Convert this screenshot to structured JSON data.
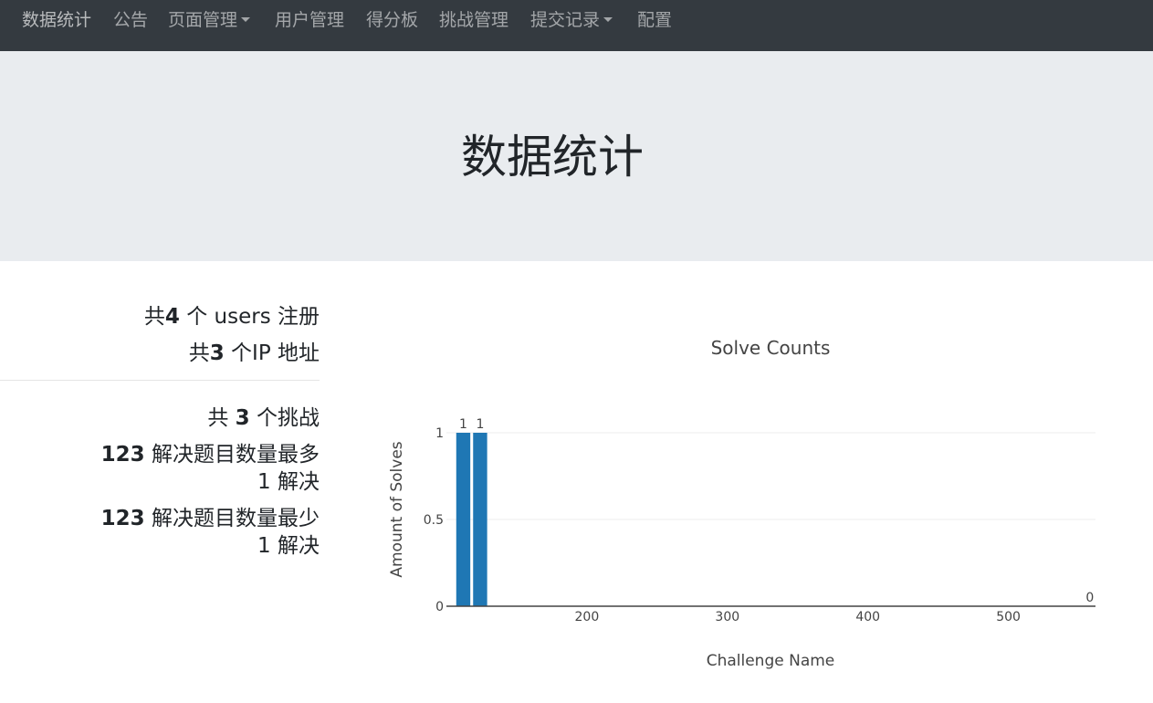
{
  "nav": {
    "items": [
      {
        "label": "数据统计",
        "active": true
      },
      {
        "label": "公告"
      },
      {
        "label": "页面管理",
        "dropdown": true
      },
      {
        "label": "用户管理"
      },
      {
        "label": "得分板"
      },
      {
        "label": "挑战管理"
      },
      {
        "label": "提交记录",
        "dropdown": true
      },
      {
        "label": "配置"
      }
    ]
  },
  "header": {
    "title": "数据统计"
  },
  "stats": {
    "users_prefix": "共",
    "users_count": "4",
    "users_suffix": " 个 users 注册",
    "ips_prefix": "共",
    "ips_count": "3",
    "ips_suffix": " 个IP 地址",
    "challenges_prefix": "共 ",
    "challenges_count": "3",
    "challenges_suffix": " 个挑战",
    "most_name": "123",
    "most_label": " 解决题目数量最多",
    "most_solves": "1 解决",
    "least_name": "123",
    "least_label": " 解决题目数量最少",
    "least_solves": "1 解决"
  },
  "colors": {
    "bar": "#1f77b4",
    "navbar": "#343a40",
    "jumbotron": "#e9ecef"
  },
  "chart_data": {
    "type": "bar",
    "title": "Solve Counts",
    "xlabel": "Challenge Name",
    "ylabel": "Amount of Solves",
    "x": [
      112,
      124,
      558
    ],
    "values": [
      1,
      1,
      0
    ],
    "data_labels": [
      "1",
      "1",
      "0"
    ],
    "xlim": [
      100,
      562
    ],
    "ylim": [
      0,
      1
    ],
    "xticks": [
      200,
      300,
      400,
      500
    ],
    "yticks": [
      0,
      0.5,
      1
    ],
    "ytick_labels": [
      "0",
      "0.5",
      "1"
    ],
    "bar_width": 10,
    "grid": true
  }
}
